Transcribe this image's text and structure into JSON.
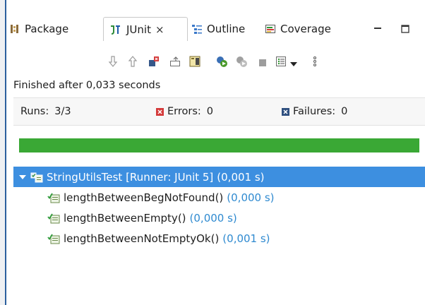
{
  "tabs": [
    {
      "label": "Package",
      "icon": "package-explorer-icon"
    },
    {
      "label": "JUnit",
      "icon": "junit-icon",
      "active": true,
      "close": "×"
    },
    {
      "label": "Outline",
      "icon": "outline-icon"
    },
    {
      "label": "Coverage",
      "icon": "coverage-icon"
    }
  ],
  "window_controls": {
    "minimize": "minimize-icon",
    "maximize": "maximize-icon"
  },
  "toolbar": [
    "next-failure-icon",
    "previous-failure-icon",
    "show-failures-only-icon",
    "scroll-lock-icon",
    "layout-icon",
    "rerun-icon",
    "rerun-failed-first-icon",
    "stop-icon",
    "history-icon",
    "dropdown-icon",
    "view-menu-icon"
  ],
  "status": "Finished after 0,033 seconds",
  "counters": {
    "runs_label": "Runs:",
    "runs_value": "3/3",
    "errors_label": "Errors:",
    "errors_value": "0",
    "failures_label": "Failures:",
    "failures_value": "0"
  },
  "progress": {
    "fraction": 1.0,
    "color": "#3aa835"
  },
  "tree": {
    "root": {
      "name": "StringUtilsTest [Runner: JUnit 5]",
      "time": "(0,001 s)"
    },
    "children": [
      {
        "name": "lengthBetweenBegNotFound()",
        "time": "(0,000 s)"
      },
      {
        "name": "lengthBetweenEmpty()",
        "time": "(0,000 s)"
      },
      {
        "name": "lengthBetweenNotEmptyOk()",
        "time": "(0,001 s)"
      }
    ]
  },
  "colors": {
    "selection": "#3d8fe0",
    "time_text": "#2f8ad0",
    "success": "#3aa835",
    "error": "#d43a3a"
  }
}
